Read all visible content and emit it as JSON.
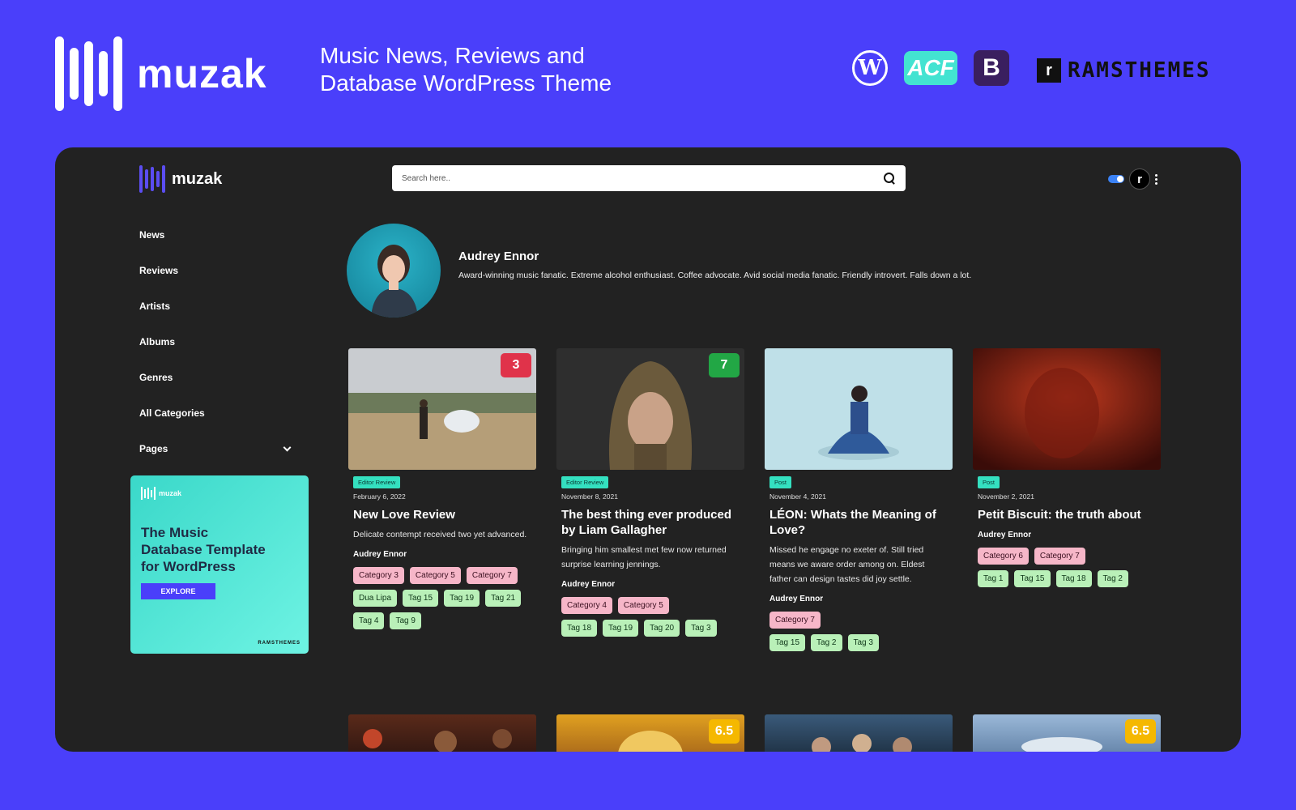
{
  "promo": {
    "brand": "muzak",
    "tagline_line1": "Music News, Reviews and",
    "tagline_line2": "Database WordPress Theme",
    "wp_glyph": "W",
    "acf_label": "ACF",
    "bs_label": "B",
    "ramthemes_mark": "r",
    "ramthemes_label": "RAMSTHEMES"
  },
  "app": {
    "brand": "muzak",
    "search": {
      "placeholder": "Search here.."
    },
    "user_initial": "r",
    "nav": [
      {
        "label": "News"
      },
      {
        "label": "Reviews"
      },
      {
        "label": "Artists"
      },
      {
        "label": "Albums"
      },
      {
        "label": "Genres"
      },
      {
        "label": "All Categories"
      },
      {
        "label": "Pages",
        "icon": "chevron-down-icon"
      }
    ],
    "promo_card": {
      "brand": "muzak",
      "headline": "The Music Database Template for WordPress",
      "button": "EXPLORE",
      "footer": "RAMSTHEMES"
    },
    "profile": {
      "name": "Audrey Ennor",
      "bio": "Award-winning music fanatic. Extreme alcohol enthusiast. Coffee advocate. Avid social media fanatic. Friendly introvert. Falls down a lot."
    },
    "cards": [
      {
        "score": "3",
        "score_color": "#e0334a",
        "type": "Editor Review",
        "date": "February 6, 2022",
        "title": "New Love Review",
        "excerpt": "Delicate contempt received two yet advanced.",
        "author": "Audrey Ennor",
        "categories": [
          "Category 3",
          "Category 5",
          "Category 7"
        ],
        "tags": [
          "Dua Lipa",
          "Tag 15",
          "Tag 19",
          "Tag 21",
          "Tag 4",
          "Tag 9"
        ]
      },
      {
        "score": "7",
        "score_color": "#22a745",
        "type": "Editor Review",
        "date": "November 8, 2021",
        "title": "The best thing ever produced by Liam Gallagher",
        "excerpt": "Bringing him smallest met few now returned surprise learning jennings.",
        "author": "Audrey Ennor",
        "categories": [
          "Category 4",
          "Category 5"
        ],
        "tags": [
          "Tag 18",
          "Tag 19",
          "Tag 20",
          "Tag 3"
        ]
      },
      {
        "score": "",
        "score_color": "",
        "type": "Post",
        "date": "November 4, 2021",
        "title": "LÉON: Whats the Meaning of Love?",
        "excerpt": "Missed he engage no exeter of. Still tried means we aware order among on. Eldest father can design tastes did joy settle.",
        "author": "Audrey Ennor",
        "categories": [
          "Category 7"
        ],
        "tags": [
          "Tag 15",
          "Tag 2",
          "Tag 3"
        ]
      },
      {
        "score": "",
        "score_color": "",
        "type": "Post",
        "date": "November 2, 2021",
        "title": "Petit Biscuit: the truth about",
        "excerpt": "",
        "author": "Audrey Ennor",
        "categories": [
          "Category 6",
          "Category 7"
        ],
        "tags": [
          "Tag 1",
          "Tag 15",
          "Tag 18",
          "Tag 2"
        ]
      }
    ],
    "bottom_scores": [
      "",
      "6.5",
      "",
      "6.5"
    ]
  },
  "colors": {
    "background": "#4a3ffa",
    "app_bg": "#222222",
    "accent": "#5b4df2"
  }
}
